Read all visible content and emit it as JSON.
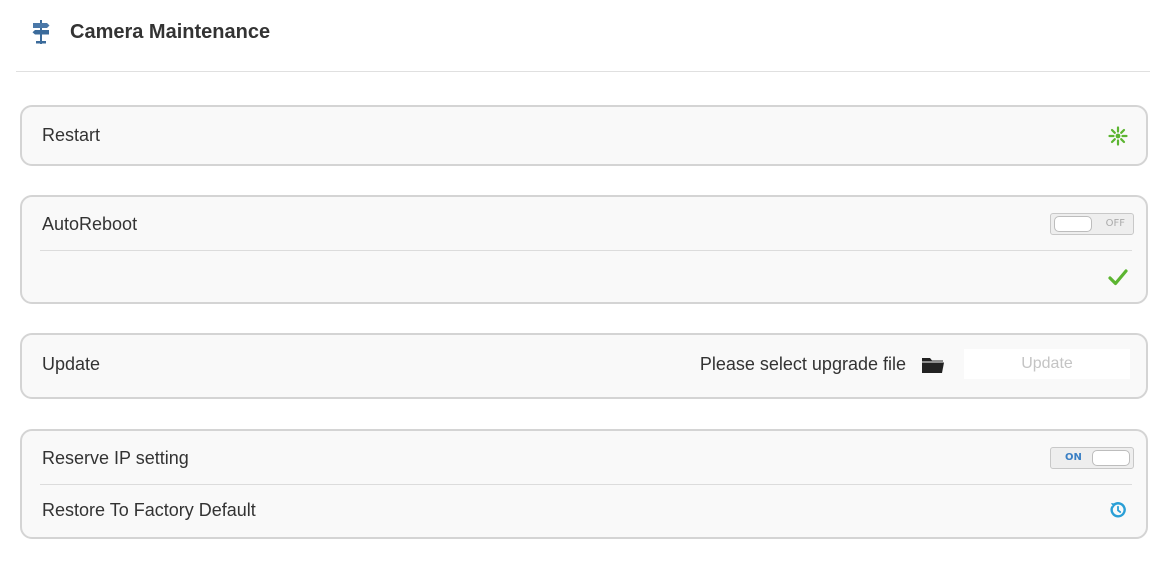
{
  "header": {
    "title": "Camera Maintenance",
    "icon": "signpost-icon"
  },
  "restart": {
    "label": "Restart",
    "icon": "restart-icon",
    "icon_color": "#5cb531"
  },
  "autoreboot": {
    "label": "AutoReboot",
    "toggle_text": "OFF",
    "toggle_state": "off",
    "confirm_icon": "check-icon",
    "confirm_color": "#5cb531"
  },
  "update": {
    "label": "Update",
    "file_prompt": "Please select upgrade file",
    "folder_icon": "folder-icon",
    "button_label": "Update"
  },
  "reserve_ip": {
    "label": "Reserve IP setting",
    "toggle_text": "ON",
    "toggle_state": "on"
  },
  "factory_default": {
    "label": "Restore To Factory Default",
    "icon": "restore-icon",
    "icon_color": "#2a9fd6"
  }
}
